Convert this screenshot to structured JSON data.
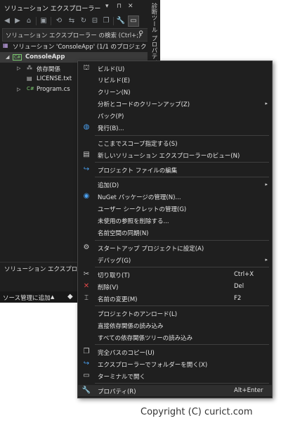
{
  "window": {
    "title": "ソリューション エクスプローラー",
    "ctl_down": "▾",
    "ctl_pin": "⊓",
    "ctl_close": "✕"
  },
  "side_tabs": [
    "診断ツール",
    "プロパティ"
  ],
  "search": {
    "placeholder": "ソリューション エクスプローラー の検索 (Ctrl+;)",
    "search_icon": "⚲",
    "dropdown_icon": "▾"
  },
  "tree": {
    "solution": "ソリューション 'ConsoleApp' (1/1 のプロジェクト)",
    "project": "ConsoleApp",
    "items": [
      "依存関係",
      "LICENSE.txt",
      "Program.cs"
    ]
  },
  "panel_title": "ソリューション エクスプローラー",
  "statusbar": {
    "source_control": "ソース管理に追加",
    "arrow": "▲"
  },
  "menu": {
    "build": {
      "label": "ビルド(U)"
    },
    "rebuild": {
      "label": "リビルド(E)"
    },
    "clean": {
      "label": "クリーン(N)"
    },
    "analyze": {
      "label": "分析とコードのクリーンアップ(Z)"
    },
    "pack": {
      "label": "パック(P)"
    },
    "publish": {
      "label": "発行(B)..."
    },
    "scope": {
      "label": "ここまでスコープ指定する(S)"
    },
    "new_view": {
      "label": "新しいソリューション エクスプローラーのビュー(N)"
    },
    "edit_project": {
      "label": "プロジェクト ファイルの編集"
    },
    "add": {
      "label": "追加(D)"
    },
    "nuget": {
      "label": "NuGet パッケージの管理(N)..."
    },
    "user_secrets": {
      "label": "ユーザー シークレットの管理(G)"
    },
    "remove_unused": {
      "label": "未使用の参照を削除する..."
    },
    "sync_ns": {
      "label": "名前空間の同期(N)"
    },
    "startup": {
      "label": "スタートアップ プロジェクトに設定(A)"
    },
    "debug": {
      "label": "デバッグ(G)"
    },
    "cut": {
      "label": "切り取り(T)",
      "shortcut": "Ctrl+X"
    },
    "delete": {
      "label": "削除(V)",
      "shortcut": "Del"
    },
    "rename": {
      "label": "名前の変更(M)",
      "shortcut": "F2"
    },
    "unload": {
      "label": "プロジェクトのアンロード(L)"
    },
    "load_direct": {
      "label": "直接依存関係の読み込み"
    },
    "load_all": {
      "label": "すべての依存関係ツリーの読み込み"
    },
    "copy_path": {
      "label": "完全パスのコピー(U)"
    },
    "open_folder": {
      "label": "エクスプローラーでフォルダーを開く(X)"
    },
    "terminal": {
      "label": "ターミナルで開く"
    },
    "properties": {
      "label": "プロパティ(R)",
      "shortcut": "Alt+Enter"
    },
    "submenu_arrow": "▸"
  },
  "colors": {
    "background": "#1f1f1f",
    "csharp_green": "#7bc96f",
    "accent_blue": "#4aa0f0",
    "delete_red": "#e04848"
  },
  "watermark": "Copyright (C) curict.com"
}
